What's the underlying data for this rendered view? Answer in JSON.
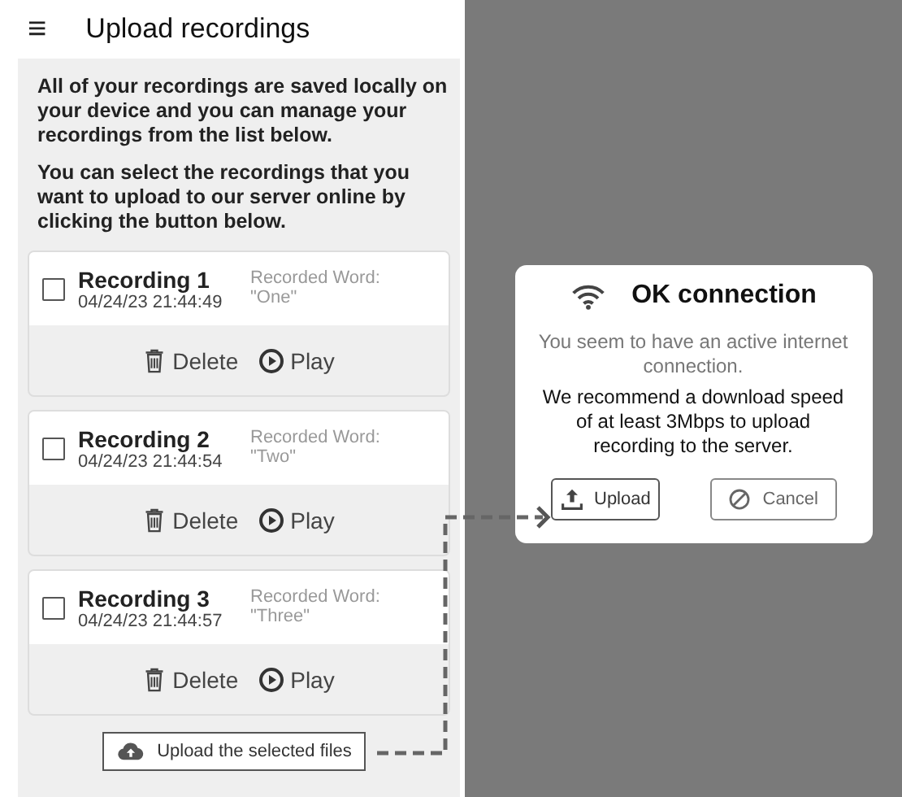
{
  "app_bar": {
    "menu_icon": "≡",
    "title": "Upload recordings"
  },
  "intro": [
    "All of your recordings are saved locally on your device and you can manage your recordings from the list below.",
    "You can select the recordings that you want to upload to our server online by clicking the button below."
  ],
  "recordings": [
    {
      "title": "Recording 1",
      "timestamp": "04/24/23 21:44:49",
      "word_label": "Recorded Word:",
      "word": "\"One\"",
      "checked": false,
      "delete_label": "Delete",
      "play_label": "Play"
    },
    {
      "title": "Recording 2",
      "timestamp": "04/24/23 21:44:54",
      "word_label": "Recorded Word:",
      "word": "\"Two\"",
      "checked": false,
      "delete_label": "Delete",
      "play_label": "Play"
    },
    {
      "title": "Recording 3",
      "timestamp": "04/24/23 21:44:57",
      "word_label": "Recorded Word:",
      "word": "\"Three\"",
      "checked": false,
      "delete_label": "Delete",
      "play_label": "Play"
    }
  ],
  "upload_button": "Upload the selected files",
  "dialog": {
    "title": "OK connection",
    "status": "You seem to have an active internet connection.",
    "message": "We recommend a download speed of at least 3Mbps to upload recording to the server.",
    "buttons": [
      {
        "kind": "upload",
        "label": "Upload"
      },
      {
        "kind": "cancel",
        "label": "Cancel"
      }
    ]
  }
}
